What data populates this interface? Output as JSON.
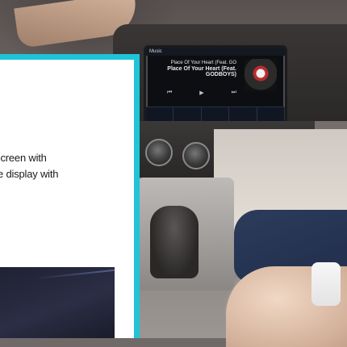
{
  "screen": {
    "top_left": "Music",
    "song_artist": "Place Of Your Heart (Feat. GO",
    "song_title": "Place Of Your Heart (Feat. GODBOYS)",
    "softkeys": [
      "",
      "",
      "",
      "",
      ""
    ]
  },
  "card": {
    "lines": [
      "tre Screen with",
      "-wide display with"
    ]
  },
  "colors": {
    "accent_border": "#1fc4d9",
    "card_bg": "#ffffff"
  }
}
